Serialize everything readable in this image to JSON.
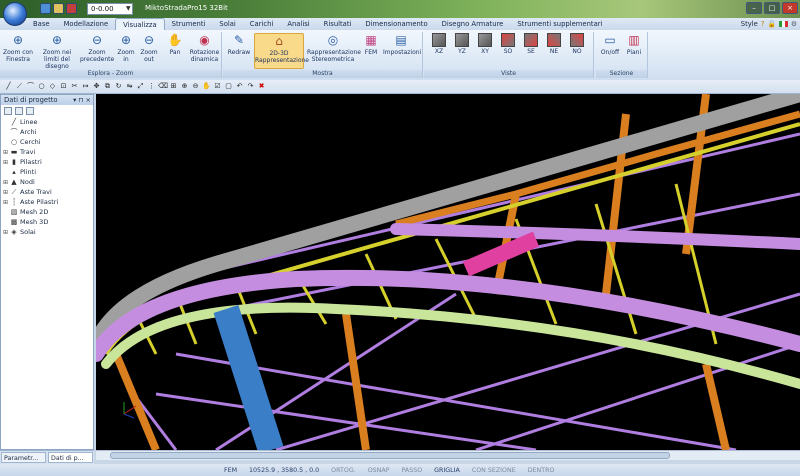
{
  "app": {
    "title": "MiktoStradaPro15 32Bit",
    "view_value": "0-0.00"
  },
  "tabs": [
    "Base",
    "Modellazione",
    "Visualizza",
    "Strumenti",
    "Solai",
    "Carichi",
    "Analisi",
    "Risultati",
    "Dimensionamento",
    "Disegno Armature",
    "Strumenti supplementari"
  ],
  "style_label": "Style",
  "ribbon": {
    "zoom": {
      "label": "Esplora - Zoom",
      "buttons": [
        "Zoom con Finestra",
        "Zoom nei limiti del disegno",
        "Zoom precedente",
        "Zoom in",
        "Zoom out",
        "Pan",
        "Rotazione dinamica"
      ]
    },
    "mostra": {
      "label": "Mostra",
      "buttons": [
        "Redraw",
        "2D-3D Rappresentazione",
        "Rappresentazione Stereometrica",
        "FEM",
        "Impostazioni"
      ]
    },
    "viste": {
      "label": "Viste",
      "buttons": [
        "XZ",
        "YZ",
        "XY",
        "SO",
        "SE",
        "NE",
        "NO"
      ]
    },
    "sezione": {
      "label": "Sezione",
      "buttons": [
        "On/off",
        "Piani"
      ]
    }
  },
  "panel": {
    "title": "Dati di progetto",
    "tree": [
      "Linee",
      "Archi",
      "Cerchi",
      "Travi",
      "Pilastri",
      "Plinti",
      "Nodi",
      "Aste Travi",
      "Aste Pilastri",
      "Mesh 2D",
      "Mesh 3D",
      "Solai"
    ],
    "tabs": [
      "Parametr...",
      "Dati di p..."
    ]
  },
  "status": {
    "fem": "FEM",
    "coords": "10525.9 , 3580.5 , 0.0",
    "ortog": "ORTOG.",
    "osnap": "OSNAP",
    "passo": "PASSO",
    "griglia": "GRIGLIA",
    "con_sezione": "CON SEZIONE",
    "dentro": "DENTRO"
  },
  "colors": {
    "viewport_bg": "#000000",
    "beam_gray": "#a0a0a0",
    "pipe_purple": "#c48de0",
    "pipe_green": "#c9e59a",
    "truss_yellow": "#d6d02c",
    "column_orange": "#d97f1f",
    "column_blue": "#3b7ec8",
    "beam_pink": "#e040a0",
    "grid_purple": "#b07ee0"
  }
}
